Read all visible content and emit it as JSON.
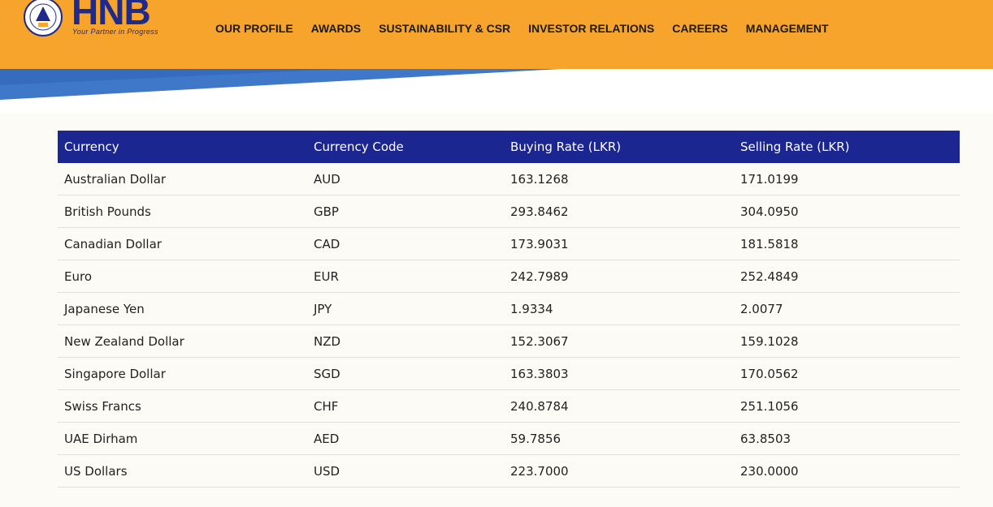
{
  "brand": {
    "name": "HNB",
    "tagline": "Your Partner in Progress",
    "colors": {
      "header": "#f6a42c",
      "navy": "#1b2690",
      "swoosh": "#3f78c8"
    }
  },
  "nav": [
    {
      "label": "OUR PROFILE"
    },
    {
      "label": "AWARDS"
    },
    {
      "label": "SUSTAINABILITY & CSR"
    },
    {
      "label": "INVESTOR RELATIONS"
    },
    {
      "label": "CAREERS"
    },
    {
      "label": "MANAGEMENT"
    }
  ],
  "table": {
    "headers": [
      "Currency",
      "Currency Code",
      "Buying Rate (LKR)",
      "Selling Rate (LKR)"
    ],
    "rows": [
      [
        "Australian Dollar",
        "AUD",
        "163.1268",
        "171.0199"
      ],
      [
        "British Pounds",
        "GBP",
        "293.8462",
        "304.0950"
      ],
      [
        "Canadian Dollar",
        "CAD",
        "173.9031",
        "181.5818"
      ],
      [
        "Euro",
        "EUR",
        "242.7989",
        "252.4849"
      ],
      [
        "Japanese Yen",
        "JPY",
        "1.9334",
        "2.0077"
      ],
      [
        "New Zealand Dollar",
        "NZD",
        "152.3067",
        "159.1028"
      ],
      [
        "Singapore Dollar",
        "SGD",
        "163.3803",
        "170.0562"
      ],
      [
        "Swiss Francs",
        "CHF",
        "240.8784",
        "251.1056"
      ],
      [
        "UAE Dirham",
        "AED",
        "59.7856",
        "63.8503"
      ],
      [
        "US Dollars",
        "USD",
        "223.7000",
        "230.0000"
      ]
    ]
  }
}
